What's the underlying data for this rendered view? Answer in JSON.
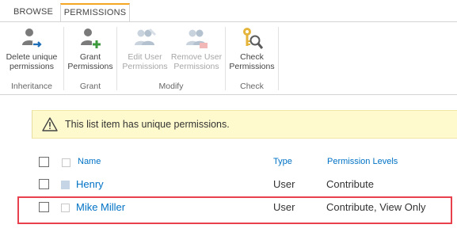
{
  "tabs": [
    {
      "label": "BROWSE",
      "active": false
    },
    {
      "label": "PERMISSIONS",
      "active": true
    }
  ],
  "ribbon": {
    "groups": [
      {
        "name": "Inheritance",
        "buttons": [
          {
            "line1": "Delete unique",
            "line2": "permissions",
            "icon": "delete-permissions-icon",
            "enabled": true
          }
        ]
      },
      {
        "name": "Grant",
        "buttons": [
          {
            "line1": "Grant",
            "line2": "Permissions",
            "icon": "grant-permissions-icon",
            "enabled": true
          }
        ]
      },
      {
        "name": "Modify",
        "buttons": [
          {
            "line1": "Edit User",
            "line2": "Permissions",
            "icon": "edit-user-permissions-icon",
            "enabled": false
          },
          {
            "line1": "Remove User",
            "line2": "Permissions",
            "icon": "remove-user-permissions-icon",
            "enabled": false
          }
        ]
      },
      {
        "name": "Check",
        "buttons": [
          {
            "line1": "Check",
            "line2": "Permissions",
            "icon": "check-permissions-icon",
            "enabled": true
          }
        ]
      }
    ]
  },
  "notice": {
    "text": "This list item has unique permissions.",
    "icon": "warning-icon"
  },
  "table": {
    "columns": [
      "Name",
      "Type",
      "Permission Levels"
    ],
    "rows": [
      {
        "name": "Henry",
        "type": "User",
        "levels": "Contribute",
        "selected": false
      },
      {
        "name": "Mike Miller",
        "type": "User",
        "levels": "Contribute, View Only",
        "selected": false
      }
    ]
  },
  "colors": {
    "accent": "#0072c6",
    "tab_accent": "#f5a623",
    "notice_bg": "#fffacd",
    "highlight": "#e8414d",
    "disabled_text": "#a6a6a6"
  }
}
